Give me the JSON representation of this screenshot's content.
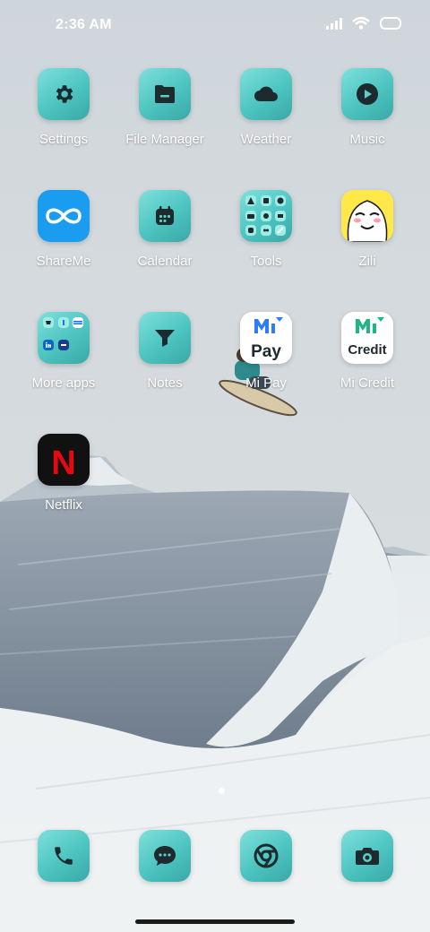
{
  "status_bar": {
    "time": "2:36 AM",
    "icons": [
      "signal-icon",
      "wifi-icon",
      "battery-icon"
    ]
  },
  "apps": [
    {
      "label": "Settings",
      "icon": "gear-icon"
    },
    {
      "label": "File Manager",
      "icon": "folder-icon"
    },
    {
      "label": "Weather",
      "icon": "cloud-icon"
    },
    {
      "label": "Music",
      "icon": "play-icon"
    },
    {
      "label": "ShareMe",
      "icon": "infinity-icon"
    },
    {
      "label": "Calendar",
      "icon": "calendar-icon"
    },
    {
      "label": "Tools",
      "icon": "folder-icon"
    },
    {
      "label": "Zili",
      "icon": "smiley-icon"
    },
    {
      "label": "More apps",
      "icon": "folder-icon"
    },
    {
      "label": "Notes",
      "icon": "funnel-icon"
    },
    {
      "label": "Mi Pay",
      "icon": "mi-pay-logo",
      "logo_text": "Pay"
    },
    {
      "label": "Mi Credit",
      "icon": "mi-credit-logo",
      "logo_text": "Credit"
    },
    {
      "label": "Netflix",
      "icon": "netflix-logo",
      "logo_text": "N"
    }
  ],
  "page_indicator": {
    "current": 1,
    "total": 1
  },
  "dock": [
    {
      "icon": "phone-icon"
    },
    {
      "icon": "messages-icon"
    },
    {
      "icon": "chrome-icon"
    },
    {
      "icon": "camera-icon"
    }
  ],
  "colors": {
    "icon_teal": "#4cc4c0",
    "label": "#ffffff",
    "netflix_red": "#e50914",
    "sharme_blue": "#1a9cf0",
    "zili_yellow": "#ffe94a"
  }
}
